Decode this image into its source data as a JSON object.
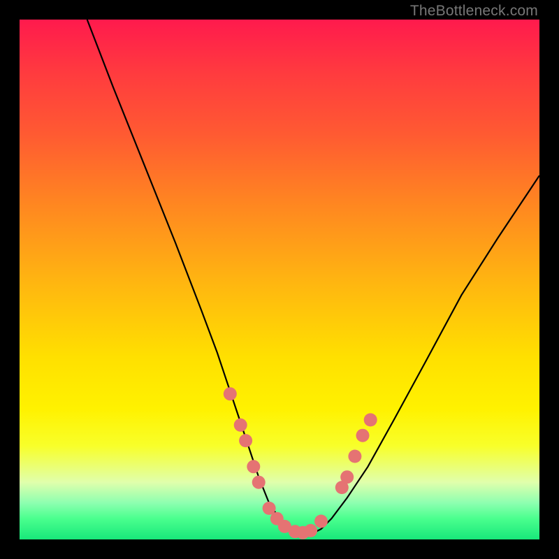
{
  "watermark": "TheBottleneck.com",
  "colors": {
    "frame": "#000000",
    "curve": "#000000",
    "dot_fill": "#e57373",
    "dot_stroke": "#d06060",
    "gradient_stops": [
      "#ff1a4d",
      "#ff3a3f",
      "#ff5a32",
      "#ff8820",
      "#ffb411",
      "#ffe000",
      "#fff200",
      "#f8ff2a",
      "#e0ffac",
      "#8dffb0",
      "#4aff8e",
      "#18e87a"
    ]
  },
  "chart_data": {
    "type": "line",
    "title": "",
    "xlabel": "",
    "ylabel": "",
    "xlim": [
      0,
      100
    ],
    "ylim": [
      0,
      100
    ],
    "grid": false,
    "legend": null,
    "series": [
      {
        "name": "bottleneck-curve",
        "x": [
          13,
          18,
          24,
          30,
          35,
          38,
          40,
          42,
          44,
          46,
          48,
          50,
          52,
          54,
          56,
          58,
          60,
          63,
          67,
          72,
          78,
          85,
          92,
          100
        ],
        "y": [
          100,
          87,
          72,
          57,
          44,
          36,
          30,
          24,
          18,
          12,
          7,
          4,
          2,
          1,
          1,
          2,
          4,
          8,
          14,
          23,
          34,
          47,
          58,
          70
        ]
      }
    ],
    "markers": [
      {
        "x": 40.5,
        "y": 28
      },
      {
        "x": 42.5,
        "y": 22
      },
      {
        "x": 43.5,
        "y": 19
      },
      {
        "x": 45.0,
        "y": 14
      },
      {
        "x": 46.0,
        "y": 11
      },
      {
        "x": 48.0,
        "y": 6
      },
      {
        "x": 49.5,
        "y": 4
      },
      {
        "x": 51.0,
        "y": 2.5
      },
      {
        "x": 53.0,
        "y": 1.5
      },
      {
        "x": 54.5,
        "y": 1.3
      },
      {
        "x": 56.0,
        "y": 1.7
      },
      {
        "x": 58.0,
        "y": 3.5
      },
      {
        "x": 62.0,
        "y": 10
      },
      {
        "x": 63.0,
        "y": 12
      },
      {
        "x": 64.5,
        "y": 16
      },
      {
        "x": 66.0,
        "y": 20
      },
      {
        "x": 67.5,
        "y": 23
      }
    ]
  }
}
